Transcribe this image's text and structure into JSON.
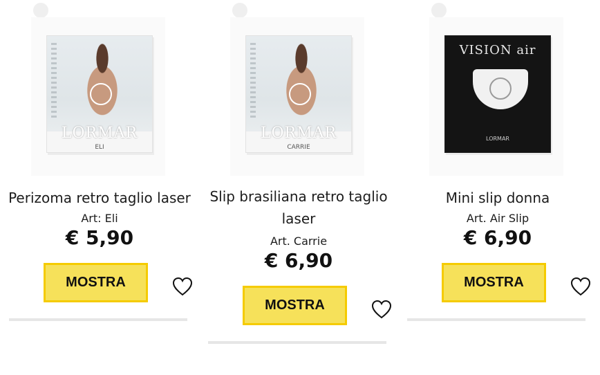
{
  "products": [
    {
      "title": "Perizoma retro taglio laser",
      "art": "Art: Eli",
      "price": "€ 5,90",
      "button_label": "MOSTRA",
      "image": {
        "brand": "LORMAR",
        "variant": "ELI"
      }
    },
    {
      "title": "Slip brasiliana retro taglio laser",
      "art": "Art. Carrie",
      "price": "€ 6,90",
      "button_label": "MOSTRA",
      "image": {
        "brand": "LORMAR",
        "variant": "CARRIE"
      }
    },
    {
      "title": "Mini slip donna",
      "art": "Art. Air Slip",
      "price": "€ 6,90",
      "button_label": "MOSTRA",
      "image": {
        "headline": "VISION air",
        "brand": "LORMAR"
      }
    }
  ],
  "icons": {
    "wishlist": "heart-outline-icon"
  },
  "colors": {
    "button_bg": "#f6e15a",
    "button_border": "#f5cb00",
    "divider": "#e6e6e6"
  }
}
